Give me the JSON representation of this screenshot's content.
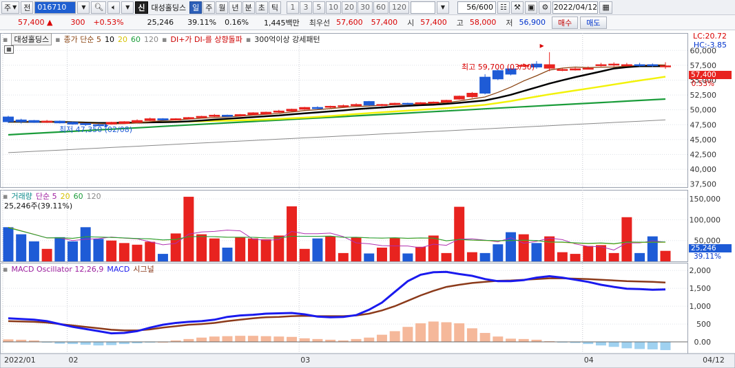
{
  "toolbar": {
    "market": "주",
    "mode": "전",
    "code": "016710",
    "period_active": "일",
    "periods": [
      "일",
      "주",
      "월",
      "년",
      "분",
      "초",
      "틱"
    ],
    "intervals": [
      "1",
      "3",
      "5",
      "10",
      "20",
      "30",
      "60",
      "120"
    ],
    "stock_name": "대성홀딩스",
    "sin": "신",
    "count": "56/600",
    "date": "2022/04/12"
  },
  "quote": {
    "price": "57,400",
    "change": "300",
    "change_pct": "+0.53%",
    "volume": "25,246",
    "volume_ratio": "39.11%",
    "turnover_ratio": "0.16%",
    "amount": "1,445백만",
    "best_label": "최우선",
    "best_ask": "57,600",
    "best_bid": "57,400",
    "open_label": "시",
    "open": "57,400",
    "high_label": "고",
    "high": "58,000",
    "low_label": "저",
    "low": "56,900",
    "buy_label": "매수",
    "sell_label": "매도",
    "colors": {
      "up": "#d90000",
      "down": "#0033cc"
    }
  },
  "price_panel": {
    "legend": {
      "name": "대성홀딩스",
      "ma_label": "종가 단순 5",
      "ma_periods": [
        "10",
        "20",
        "60",
        "120"
      ],
      "signal1": "DI+가 DI-를 상향돌파",
      "signal2": "300억이상 강세패턴"
    },
    "lc": "LC:20.72",
    "hc": "HC:-3.85",
    "last_price": "57,400",
    "last_pct": "0.53%",
    "max_annotation": "최고 59,700 (03/30)",
    "min_annotation": "최저 47,350 (02/08)",
    "ticks": [
      "60,000",
      "57,500",
      "55,000",
      "52,500",
      "50,000",
      "47,500",
      "45,000",
      "42,500",
      "40,000",
      "37,500"
    ]
  },
  "volume_panel": {
    "legend": {
      "label": "거래량",
      "ma": "단순 5",
      "periods": [
        "20",
        "60",
        "120"
      ]
    },
    "current": "25,246주(39.11%)",
    "badge_value": "25,246",
    "badge_pct": "39.11%",
    "ticks": [
      "150,000",
      "100,000",
      "50,000"
    ]
  },
  "macd_panel": {
    "legend": {
      "osc": "MACD Oscillator 12,26,9",
      "macd": "MACD",
      "signal": "시그널"
    },
    "ticks": [
      "2,000",
      "1,500",
      "1,000",
      "500",
      "0.00"
    ]
  },
  "x_axis": {
    "labels": [
      "2022/01",
      "02",
      "03",
      "04"
    ],
    "last": "04/12"
  },
  "chart_data": {
    "type": "candlestick",
    "x_dates": [
      "01/24",
      "01/25",
      "01/26",
      "01/27",
      "01/28",
      "02/03",
      "02/04",
      "02/07",
      "02/08",
      "02/09",
      "02/10",
      "02/11",
      "02/14",
      "02/15",
      "02/16",
      "02/17",
      "02/18",
      "02/21",
      "02/22",
      "02/23",
      "02/24",
      "02/25",
      "02/28",
      "03/02",
      "03/03",
      "03/04",
      "03/07",
      "03/08",
      "03/10",
      "03/11",
      "03/14",
      "03/15",
      "03/16",
      "03/17",
      "03/18",
      "03/21",
      "03/22",
      "03/23",
      "03/24",
      "03/25",
      "03/28",
      "03/29",
      "03/30",
      "03/31",
      "04/01",
      "04/04",
      "04/05",
      "04/06",
      "04/07",
      "04/08",
      "04/11",
      "04/12"
    ],
    "ohlc_note": "values in KRW",
    "open": [
      48800,
      48300,
      48200,
      47900,
      48100,
      47900,
      47700,
      47500,
      47600,
      47700,
      47900,
      48200,
      48500,
      48300,
      48500,
      48700,
      48900,
      49100,
      49000,
      49200,
      49300,
      49600,
      49800,
      50100,
      50400,
      50500,
      50600,
      50700,
      51400,
      50800,
      50900,
      51100,
      51000,
      51200,
      51300,
      51800,
      52200,
      55500,
      56600,
      56900,
      57400,
      57700,
      57000,
      56700,
      56700,
      56900,
      57600,
      57600,
      57500,
      57600,
      57600,
      57400
    ],
    "close": [
      48000,
      48000,
      47900,
      48100,
      47800,
      47600,
      47500,
      47400,
      47900,
      48000,
      48200,
      48500,
      48300,
      48500,
      48700,
      48900,
      49100,
      48900,
      49200,
      49500,
      49600,
      49800,
      50100,
      50400,
      50200,
      50600,
      50700,
      50900,
      50800,
      50900,
      51100,
      51000,
      51200,
      51300,
      51600,
      52300,
      52800,
      52800,
      55200,
      56000,
      57500,
      57200,
      57600,
      56800,
      56900,
      57000,
      57600,
      57700,
      57600,
      57500,
      57500,
      57400
    ],
    "high": [
      49000,
      48500,
      48300,
      48300,
      48200,
      48000,
      47800,
      47700,
      48000,
      48100,
      48400,
      48700,
      48600,
      48600,
      48800,
      49000,
      49300,
      49200,
      49300,
      49600,
      49700,
      50000,
      50200,
      50500,
      50600,
      50700,
      50900,
      51100,
      51500,
      51000,
      51200,
      51200,
      51300,
      51400,
      51700,
      52400,
      53000,
      56000,
      56800,
      57200,
      57800,
      58200,
      59700,
      57000,
      57100,
      57300,
      57900,
      58000,
      57900,
      57900,
      57800,
      58000
    ],
    "low": [
      47800,
      47700,
      47800,
      47800,
      47700,
      47500,
      47300,
      47350,
      47500,
      47600,
      47800,
      48100,
      48200,
      48200,
      48400,
      48600,
      48800,
      48800,
      48900,
      49100,
      49200,
      49500,
      49700,
      50000,
      50100,
      50300,
      50500,
      50600,
      50700,
      50600,
      50800,
      50900,
      50900,
      51100,
      51200,
      51700,
      52000,
      52600,
      55000,
      55800,
      57200,
      56900,
      56500,
      56500,
      56600,
      56800,
      57300,
      57300,
      57300,
      57300,
      57200,
      56900
    ],
    "volume": [
      82000,
      65000,
      48000,
      30000,
      58000,
      48000,
      82000,
      54000,
      50000,
      44000,
      40000,
      47000,
      18000,
      67000,
      155000,
      65000,
      55000,
      33000,
      58000,
      55000,
      53000,
      62000,
      132000,
      30000,
      55000,
      60000,
      20000,
      57000,
      19000,
      33000,
      57000,
      19000,
      35000,
      62000,
      20000,
      131000,
      22000,
      20000,
      41000,
      70000,
      65000,
      44000,
      60000,
      22000,
      18000,
      37000,
      39000,
      20000,
      106000,
      20000,
      60000,
      25246
    ],
    "macd_osc": [
      70,
      60,
      40,
      -20,
      -50,
      -60,
      -80,
      -100,
      -90,
      -60,
      -40,
      -20,
      0,
      40,
      80,
      120,
      150,
      160,
      170,
      170,
      160,
      150,
      140,
      100,
      80,
      60,
      40,
      80,
      120,
      200,
      300,
      420,
      520,
      570,
      550,
      520,
      380,
      250,
      150,
      90,
      80,
      60,
      20,
      -10,
      -30,
      -60,
      -100,
      -140,
      -180,
      -200,
      -210,
      -230
    ],
    "macd": [
      660,
      640,
      620,
      580,
      500,
      420,
      360,
      300,
      240,
      250,
      300,
      400,
      480,
      530,
      560,
      580,
      620,
      700,
      740,
      760,
      790,
      800,
      810,
      770,
      710,
      690,
      700,
      750,
      900,
      1100,
      1400,
      1700,
      1880,
      1950,
      1960,
      1900,
      1850,
      1760,
      1700,
      1700,
      1730,
      1800,
      1840,
      1800,
      1740,
      1680,
      1600,
      1540,
      1490,
      1480,
      1460,
      1470
    ],
    "signal": [
      580,
      570,
      560,
      540,
      500,
      460,
      420,
      380,
      340,
      320,
      320,
      350,
      400,
      440,
      480,
      500,
      530,
      580,
      620,
      660,
      690,
      700,
      720,
      730,
      720,
      720,
      720,
      740,
      790,
      880,
      1000,
      1150,
      1300,
      1430,
      1540,
      1600,
      1650,
      1680,
      1710,
      1720,
      1740,
      1760,
      1780,
      1780,
      1770,
      1760,
      1740,
      1720,
      1700,
      1690,
      1680,
      1660
    ],
    "price_ylim": [
      37000,
      62000
    ],
    "volume_ylim": [
      0,
      165000
    ],
    "macd_ylim": [
      -250,
      2100
    ],
    "colors": {
      "up": "#e8231f",
      "down": "#1e5bd6",
      "ma5": "#8b4513",
      "ma10": "#000000",
      "ma20": "#f2f20a",
      "ma60": "#1a9c3a",
      "ma120": "#888888",
      "macd": "#1a1aee",
      "signal": "#8b3a1a",
      "osc_pos": "#f5b89a",
      "osc_neg": "#9fd1f0"
    }
  }
}
